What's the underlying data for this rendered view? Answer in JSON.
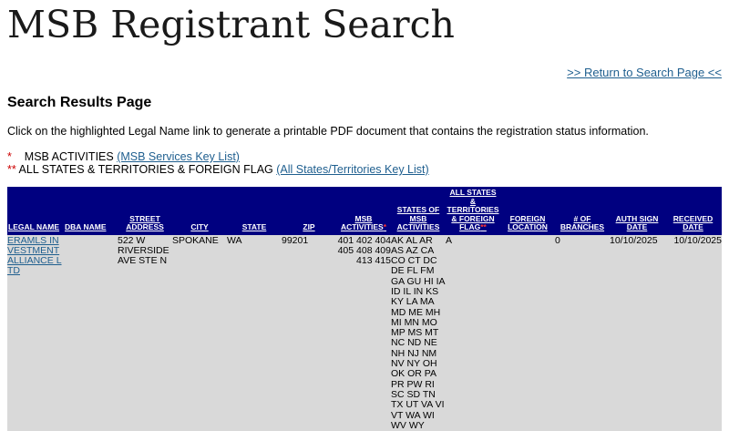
{
  "page": {
    "site_title": "MSB Registrant Search",
    "return_link": ">> Return to Search Page <<",
    "results_heading": "Search Results Page",
    "instructions": "Click on the highlighted Legal Name link to generate a printable PDF document that contains the registration status information."
  },
  "legend": {
    "msb_marker": "*",
    "msb_label": "MSB ACTIVITIES",
    "msb_link": "(MSB Services Key List)",
    "states_marker": "**",
    "states_label": "ALL STATES & TERRITORIES & FOREIGN FLAG",
    "states_link": "(All States/Territories Key List)"
  },
  "colors": {
    "header_bg": "#000080",
    "row_bg": "#d9d9d9",
    "link": "#1f5f8f",
    "marker": "#cc0000"
  },
  "table": {
    "columns": {
      "legal_name": "Legal Name",
      "dba_name": "DBA Name",
      "street_address": "Street Address",
      "city": "City",
      "state": "State",
      "zip": "Zip",
      "msb_activities": "MSB Activities",
      "msb_activities_marker": "*",
      "states_of_msb": "States of MSB Activities",
      "all_states": "All States & Territories & Foreign Flag",
      "all_states_marker": "**",
      "foreign_location": "Foreign Location",
      "branches": "# of Branches",
      "auth_sign_date": "Auth Sign Date",
      "received_date": "Received Date"
    },
    "rows": [
      {
        "legal_name": "ERAMLS INVESTMENT ALLIANCE LTD",
        "dba_name": "",
        "street_address": "522 W RIVERSIDE AVE STE N",
        "city": "SPOKANE",
        "state": "WA",
        "zip": "99201",
        "msb_activities": "401 402 404 405 408 409 413 415",
        "states_of_msb": "AK AL AR AS AZ CA CO CT DC DE FL FM GA GU HI IA ID IL IN KS KY LA MA MD ME MH MI MN MO MP MS MT NC ND NE NH NJ NM NV NY OH OK OR PA PR PW RI SC SD TN TX UT VA VI VT WA WI WV WY",
        "all_states": "A",
        "foreign_location": "",
        "branches": "0",
        "auth_sign_date": "10/10/2025",
        "received_date": "10/10/2025"
      }
    ]
  }
}
